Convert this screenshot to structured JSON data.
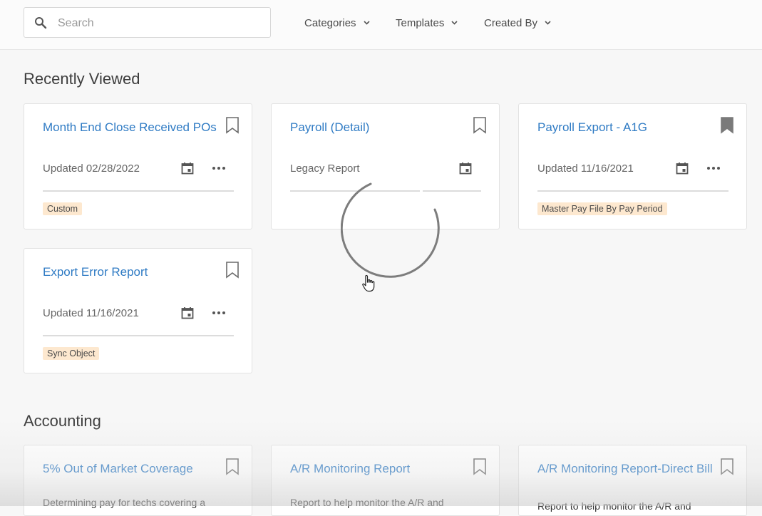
{
  "search": {
    "placeholder": "Search",
    "value": ""
  },
  "filters": [
    {
      "label": "Categories"
    },
    {
      "label": "Templates"
    },
    {
      "label": "Created By"
    }
  ],
  "recently_viewed": {
    "title": "Recently Viewed",
    "cards": [
      {
        "title": "Month End Close Received POs",
        "meta": "Updated 02/28/2022",
        "tag": "Custom",
        "bookmarked": false
      },
      {
        "title": "Payroll (Detail)",
        "meta": "Legacy Report",
        "tag": "",
        "bookmarked": false
      },
      {
        "title": "Payroll Export - A1G",
        "meta": "Updated 11/16/2021",
        "tag": "Master Pay File By Pay Period",
        "bookmarked": true
      },
      {
        "title": "Export Error Report",
        "meta": "Updated 11/16/2021",
        "tag": "Sync Object",
        "bookmarked": false
      }
    ]
  },
  "accounting": {
    "title": "Accounting",
    "cards": [
      {
        "title": "5% Out of Market Coverage",
        "description": "Determining pay for techs covering a"
      },
      {
        "title": "A/R Monitoring Report",
        "description": "Report to help monitor the A/R and"
      },
      {
        "title": "A/R Monitoring Report-Direct Bill",
        "description": "Report to help monitor the A/R and"
      }
    ]
  },
  "colors": {
    "link": "#2f7bc4",
    "tag_bg": "#fde8cf",
    "icon": "#6b6b6b",
    "bookmark_filled": "#7a7a7a"
  },
  "icons": [
    "search-icon",
    "chevron-down-icon",
    "bookmark-icon",
    "bookmark-filled-icon",
    "calendar-icon",
    "more-icon",
    "loading-spinner",
    "hand-cursor-icon"
  ]
}
